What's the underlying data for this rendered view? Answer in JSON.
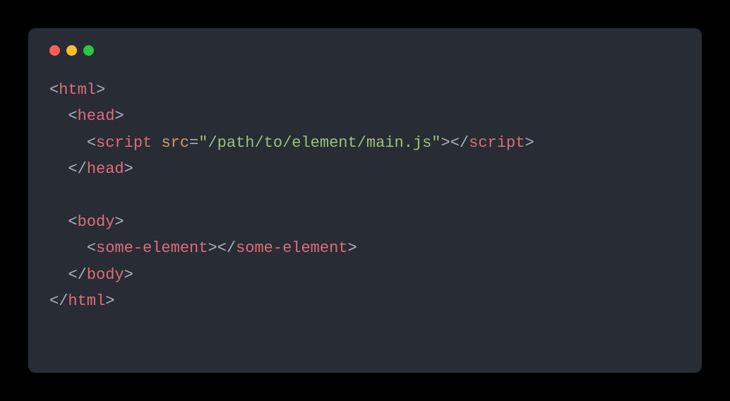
{
  "code": {
    "lines": [
      {
        "indent": 0,
        "tokens": [
          {
            "t": "<",
            "c": "punct"
          },
          {
            "t": "html",
            "c": "tag"
          },
          {
            "t": ">",
            "c": "punct"
          }
        ]
      },
      {
        "indent": 1,
        "tokens": [
          {
            "t": "<",
            "c": "punct"
          },
          {
            "t": "head",
            "c": "tag"
          },
          {
            "t": ">",
            "c": "punct"
          }
        ]
      },
      {
        "indent": 2,
        "tokens": [
          {
            "t": "<",
            "c": "punct"
          },
          {
            "t": "script",
            "c": "tag"
          },
          {
            "t": " ",
            "c": "punct"
          },
          {
            "t": "src",
            "c": "attr"
          },
          {
            "t": "=",
            "c": "eq"
          },
          {
            "t": "\"/path/to/element/main.js\"",
            "c": "string"
          },
          {
            "t": ">",
            "c": "punct"
          },
          {
            "t": "</",
            "c": "punct"
          },
          {
            "t": "script",
            "c": "tag"
          },
          {
            "t": ">",
            "c": "punct"
          }
        ]
      },
      {
        "indent": 1,
        "tokens": [
          {
            "t": "</",
            "c": "punct"
          },
          {
            "t": "head",
            "c": "tag"
          },
          {
            "t": ">",
            "c": "punct"
          }
        ]
      },
      {
        "indent": 0,
        "tokens": [
          {
            "t": " ",
            "c": "punct"
          }
        ]
      },
      {
        "indent": 1,
        "tokens": [
          {
            "t": "<",
            "c": "punct"
          },
          {
            "t": "body",
            "c": "tag"
          },
          {
            "t": ">",
            "c": "punct"
          }
        ]
      },
      {
        "indent": 2,
        "tokens": [
          {
            "t": "<",
            "c": "punct"
          },
          {
            "t": "some-element",
            "c": "tag"
          },
          {
            "t": ">",
            "c": "punct"
          },
          {
            "t": "</",
            "c": "punct"
          },
          {
            "t": "some-element",
            "c": "tag"
          },
          {
            "t": ">",
            "c": "punct"
          }
        ]
      },
      {
        "indent": 1,
        "tokens": [
          {
            "t": "</",
            "c": "punct"
          },
          {
            "t": "body",
            "c": "tag"
          },
          {
            "t": ">",
            "c": "punct"
          }
        ]
      },
      {
        "indent": 0,
        "tokens": [
          {
            "t": "</",
            "c": "punct"
          },
          {
            "t": "html",
            "c": "tag"
          },
          {
            "t": ">",
            "c": "punct"
          }
        ]
      }
    ],
    "indent_unit": "  "
  }
}
